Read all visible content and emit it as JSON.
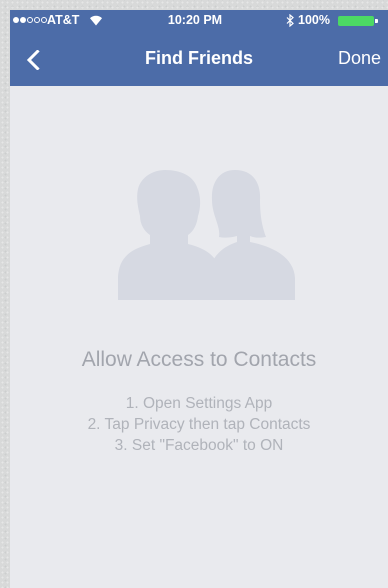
{
  "status_bar": {
    "carrier": "AT&T",
    "time": "10:20 PM",
    "battery": "100%",
    "signal_strength": 2,
    "signal_dots": 5
  },
  "nav": {
    "title": "Find Friends",
    "done_label": "Done",
    "back_icon": "chevron-left-icon"
  },
  "content": {
    "heading": "Allow Access to Contacts",
    "steps": [
      "1. Open Settings App",
      "2. Tap Privacy then tap Contacts",
      "3. Set \"Facebook\" to ON"
    ]
  },
  "colors": {
    "nav_background": "#4c6ca8",
    "page_background": "#e9eaee",
    "battery_fill": "#4cd964",
    "icon_fill": "#d6d9e2",
    "heading_text": "#a2a5ad"
  }
}
